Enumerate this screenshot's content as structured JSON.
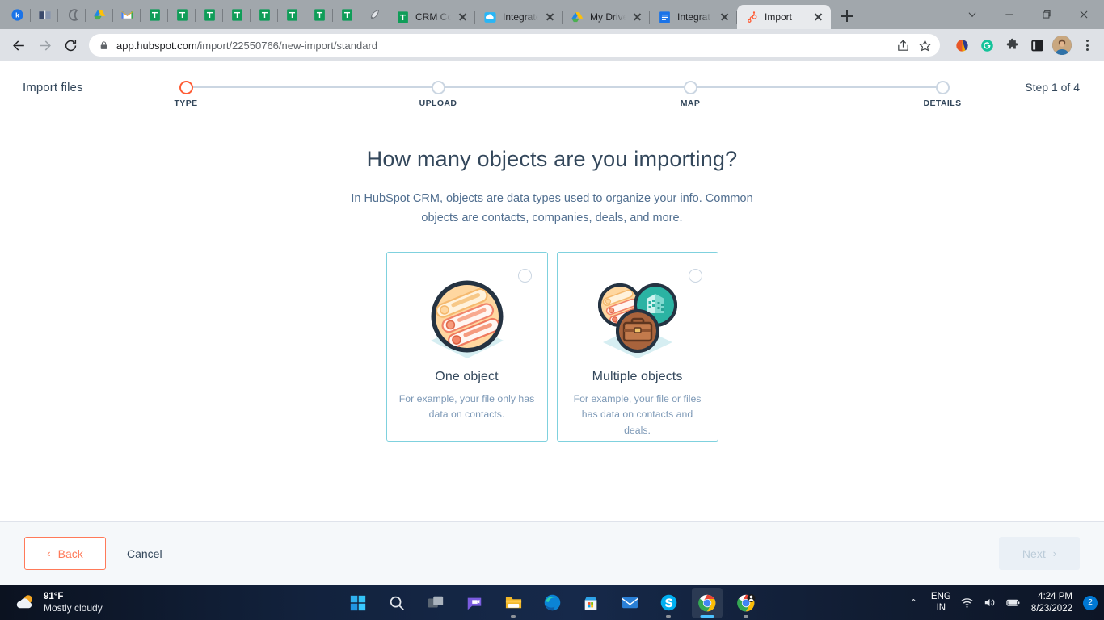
{
  "browser": {
    "pinned_tabs": [
      {
        "name": "klaviyo-pinned-tab",
        "icon": "k-circle-icon"
      },
      {
        "name": "book-pinned-tab",
        "icon": "book-icon"
      },
      {
        "name": "crescent-pinned-tab",
        "icon": "crescent-icon"
      },
      {
        "name": "google-drive-pinned-tab",
        "icon": "google-drive-icon"
      },
      {
        "name": "gmail-pinned-tab",
        "icon": "gmail-icon"
      },
      {
        "name": "sheets-pinned-tab-1",
        "icon": "google-sheets-icon"
      },
      {
        "name": "sheets-pinned-tab-2",
        "icon": "google-sheets-icon"
      },
      {
        "name": "sheets-pinned-tab-3",
        "icon": "google-sheets-icon"
      },
      {
        "name": "sheets-pinned-tab-4",
        "icon": "google-sheets-icon"
      },
      {
        "name": "sheets-pinned-tab-5",
        "icon": "google-sheets-icon"
      },
      {
        "name": "sheets-pinned-tab-6",
        "icon": "google-sheets-icon"
      },
      {
        "name": "sheets-pinned-tab-7",
        "icon": "google-sheets-icon"
      },
      {
        "name": "sheets-pinned-tab-8",
        "icon": "google-sheets-icon"
      },
      {
        "name": "feather-pinned-tab",
        "icon": "feather-icon"
      }
    ],
    "tabs": [
      {
        "title": "CRM Co",
        "icon": "google-sheets-icon",
        "active": false
      },
      {
        "title": "Integrate",
        "icon": "cloud-icon",
        "active": false
      },
      {
        "title": "My Drive",
        "icon": "google-drive-icon",
        "active": false
      },
      {
        "title": "Integrat",
        "icon": "google-docs-icon",
        "active": false
      },
      {
        "title": "Import",
        "icon": "hubspot-icon",
        "active": true
      }
    ],
    "new_tab_label": "New tab",
    "window_controls": [
      "chevron-down-icon",
      "minimize-icon",
      "maximize-icon",
      "close-icon"
    ],
    "address": {
      "host": "app.hubspot.com",
      "path": "/import/22550766/new-import/standard",
      "lock_icon": "lock-icon"
    },
    "toolbar_icons": [
      "back-icon",
      "forward-icon",
      "reload-icon",
      "share-icon",
      "bookmark-star-icon",
      "coreldraw-extension-icon",
      "grammarly-extension-icon",
      "extensions-puzzle-icon",
      "sidepanel-icon",
      "profile-avatar",
      "chrome-menu-icon"
    ]
  },
  "app": {
    "title": "Import files",
    "step_counter": "Step 1 of 4",
    "steps": [
      {
        "label": "TYPE",
        "current": true
      },
      {
        "label": "UPLOAD",
        "current": false
      },
      {
        "label": "MAP",
        "current": false
      },
      {
        "label": "DETAILS",
        "current": false
      }
    ],
    "headline": "How many objects are you importing?",
    "subhead": "In HubSpot CRM, objects are data types used to organize your info. Common objects are contacts, companies, deals, and more.",
    "options": [
      {
        "title": "One object",
        "description": "For example, your file only has data on contacts.",
        "illustration": "single-contacts-list-icon",
        "selected": false
      },
      {
        "title": "Multiple objects",
        "description": "For example, your file or files has data on contacts and deals.",
        "illustration": "contacts-companies-deals-icon",
        "selected": false
      }
    ],
    "footer": {
      "back_label": "Back",
      "back_chevron": "‹",
      "cancel_label": "Cancel",
      "next_label": "Next",
      "next_chevron": "›",
      "next_disabled": true
    },
    "colors": {
      "accent_orange": "#ff5c35",
      "card_border_teal": "#7fd1de",
      "text_navy": "#33475b",
      "muted_blue": "#7c98b6",
      "next_disabled_bg": "#eaf0f6"
    }
  },
  "taskbar": {
    "weather": {
      "temperature": "91°F",
      "condition": "Mostly cloudy",
      "icon": "sun-cloud-icon"
    },
    "items": [
      {
        "name": "start-button",
        "icon": "windows-start-icon"
      },
      {
        "name": "search-button",
        "icon": "search-icon"
      },
      {
        "name": "task-view-button",
        "icon": "task-view-icon"
      },
      {
        "name": "teams-button",
        "icon": "teams-chat-icon"
      },
      {
        "name": "file-explorer-button",
        "icon": "folder-icon"
      },
      {
        "name": "edge-button",
        "icon": "edge-icon"
      },
      {
        "name": "microsoft-store-button",
        "icon": "store-icon"
      },
      {
        "name": "mail-button",
        "icon": "mail-envelope-icon"
      },
      {
        "name": "skype-button",
        "icon": "skype-icon"
      },
      {
        "name": "chrome-button",
        "icon": "chrome-icon"
      },
      {
        "name": "chrome-profile-button",
        "icon": "chrome-profile-icon"
      }
    ],
    "tray": {
      "overflow_chevron": "⌃",
      "language_primary": "ENG",
      "language_secondary": "IN",
      "icons": [
        "wifi-icon",
        "volume-icon",
        "battery-icon"
      ],
      "time": "4:24 PM",
      "date": "8/23/2022",
      "notification_count": "2"
    }
  }
}
